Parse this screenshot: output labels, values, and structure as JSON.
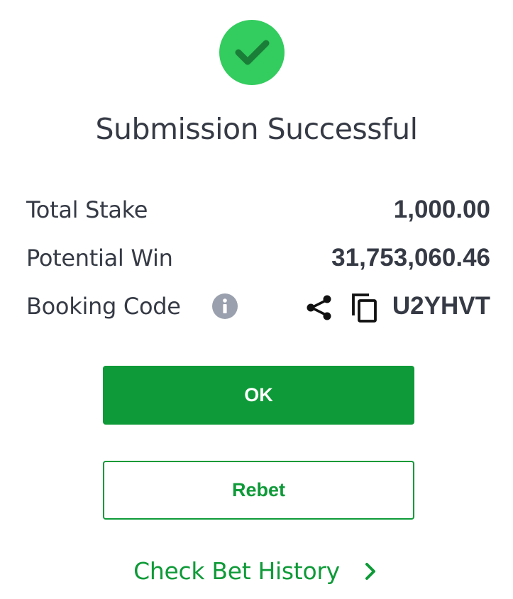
{
  "dialog": {
    "title": "Submission Successful",
    "status_icon": "checkmark-circle-icon",
    "rows": [
      {
        "label": "Total Stake",
        "value": "1,000.00"
      },
      {
        "label": "Potential Win",
        "value": "31,753,060.46"
      },
      {
        "label": "Booking Code",
        "value": "U2YHVT"
      }
    ],
    "booking_icons": [
      "info-icon",
      "share-icon",
      "copy-icon"
    ],
    "buttons": {
      "ok_label": "OK",
      "rebet_label": "Rebet"
    },
    "history_link_label": "Check Bet History",
    "history_link_icon": "chevron-right-icon"
  },
  "colors": {
    "success_green": "#33cc5e",
    "brand_green": "#0e9a38",
    "text_dark": "#353a45",
    "info_gray": "#9aa0ad"
  }
}
